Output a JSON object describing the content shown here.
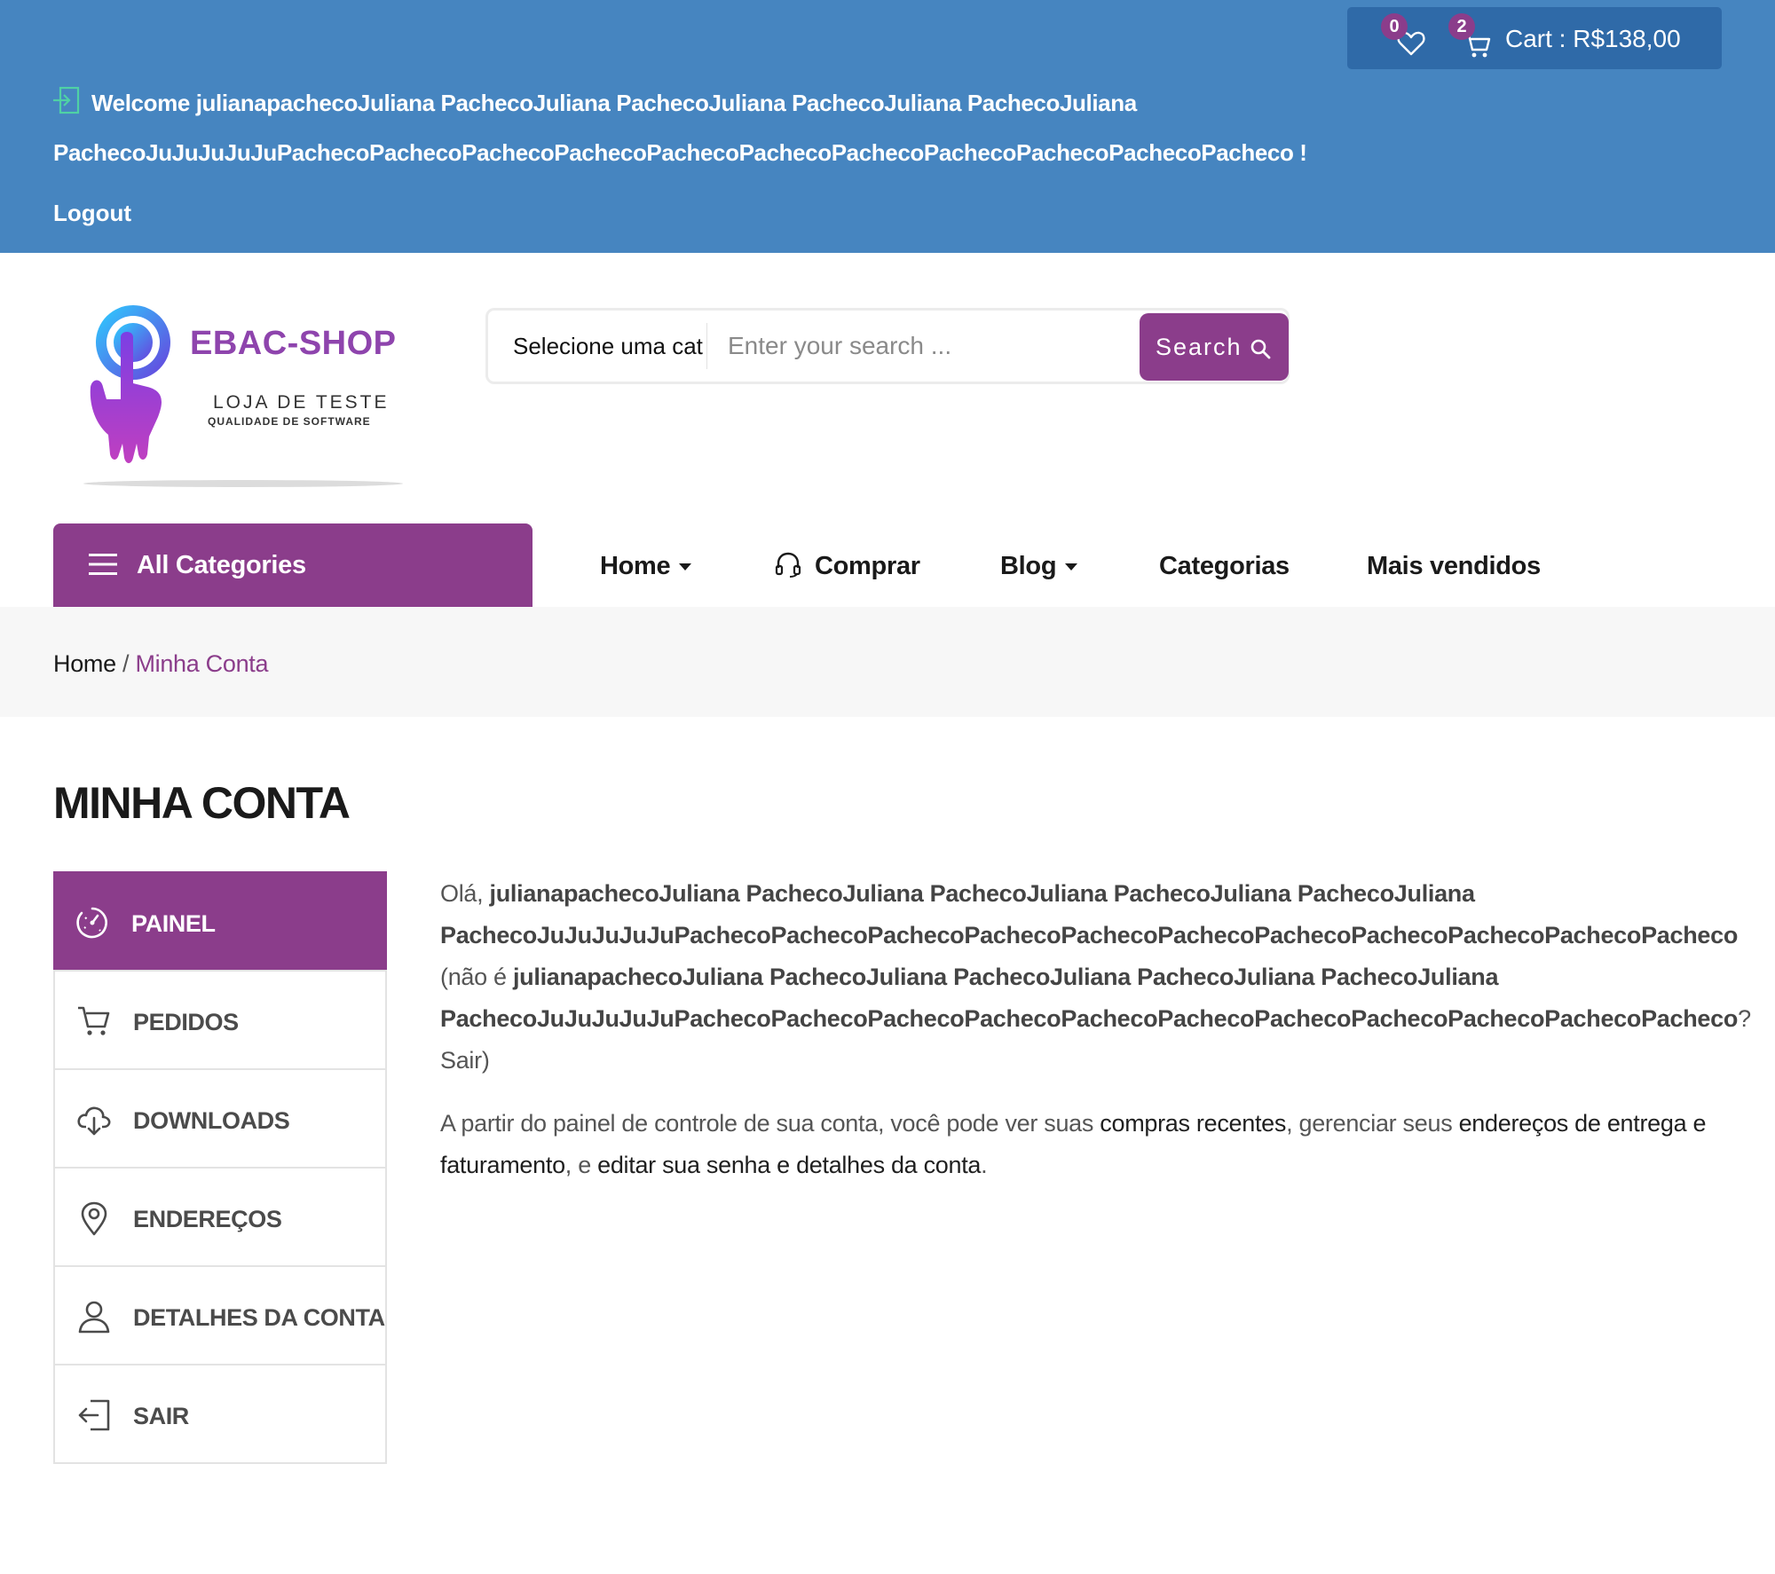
{
  "topbar": {
    "wishlist_count": "0",
    "cart_count": "2",
    "cart_label": "Cart : R$138,00",
    "welcome_text": "Welcome julianapachecoJuliana PachecoJuliana PachecoJuliana PachecoJuliana PachecoJuliana PachecoJuJuJuJuJuPachecoPachecoPachecoPachecoPachecoPachecoPachecoPachecoPachecoPachecoPacheco !",
    "logout_label": "Logout"
  },
  "logo": {
    "brand": "EBAC-SHOP",
    "subtitle": "LOJA DE TESTE",
    "tagline": "QUALIDADE DE SOFTWARE"
  },
  "search": {
    "category_label": "Selecione uma cat",
    "placeholder": "Enter your search ...",
    "button_label": "Search"
  },
  "nav": {
    "all_categories": "All Categories",
    "items": [
      {
        "label": "Home",
        "has_dropdown": true
      },
      {
        "label": "Comprar",
        "icon": "headset-icon"
      },
      {
        "label": "Blog",
        "has_dropdown": true
      },
      {
        "label": "Categorias"
      },
      {
        "label": "Mais vendidos"
      }
    ]
  },
  "breadcrumb": {
    "home": "Home",
    "separator": "/",
    "current": "Minha Conta"
  },
  "page_title": "MINHA CONTA",
  "account_menu": {
    "items": [
      {
        "label": "PAINEL",
        "icon": "dashboard-icon",
        "active": true
      },
      {
        "label": "PEDIDOS",
        "icon": "cart-icon"
      },
      {
        "label": "DOWNLOADS",
        "icon": "cloud-download-icon"
      },
      {
        "label": "ENDEREÇOS",
        "icon": "map-pin-icon"
      },
      {
        "label": "DETALHES DA CONTA",
        "icon": "user-icon"
      },
      {
        "label": "SAIR",
        "icon": "logout-icon"
      }
    ]
  },
  "content": {
    "hello_prefix": "Olá, ",
    "username": "julianapachecoJuliana PachecoJuliana PachecoJuliana PachecoJuliana PachecoJuliana PachecoJuJuJuJuJuPachecoPachecoPachecoPachecoPachecoPachecoPachecoPachecoPachecoPachecoPacheco",
    "not_prefix": " (não é ",
    "not_suffix": "? ",
    "sair_link": "Sair",
    "close_paren": ")",
    "intro_text": "A partir do painel de controle de sua conta, você pode ver suas ",
    "link_orders": "compras recentes",
    "mid_text": ", gerenciar seus ",
    "link_addresses": "endereços de entrega e faturamento",
    "and_text": ", e ",
    "link_account": "editar sua senha e detalhes da conta",
    "end_text": "."
  },
  "colors": {
    "topbar": "#4685c0",
    "cart_box": "#2f6aa8",
    "brand_purple": "#8b3d8b",
    "breadcrumb_band": "#f7f7f7"
  }
}
